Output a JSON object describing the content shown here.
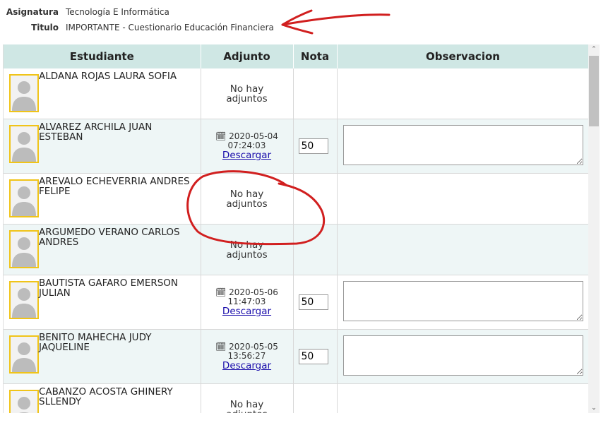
{
  "meta": {
    "asignatura_label": "Asignatura",
    "asignatura_value": "Tecnología E Informática",
    "titulo_label": "Titulo",
    "titulo_value": "IMPORTANTE - Cuestionario Educación Financiera"
  },
  "table": {
    "headers": [
      "Estudiante",
      "Adjunto",
      "Nota",
      "Observacion"
    ],
    "rows": [
      {
        "name": "ALDANA ROJAS LAURA SOFIA",
        "no_attachment": "No hay adjuntos"
      },
      {
        "name": "ALVAREZ ARCHILA JUAN ESTEBAN",
        "date": "2020-05-04",
        "time": "07:24:03",
        "download": "Descargar",
        "nota": "50"
      },
      {
        "name": "AREVALO ECHEVERRIA ANDRES FELIPE",
        "no_attachment": "No hay adjuntos"
      },
      {
        "name": "ARGUMEDO VERANO CARLOS ANDRES",
        "no_attachment": "No hay adjuntos"
      },
      {
        "name": "BAUTISTA GAFARO EMERSON JULIAN",
        "date": "2020-05-06",
        "time": "11:47:03",
        "download": "Descargar",
        "nota": "50"
      },
      {
        "name": "BENITO MAHECHA JUDY JAQUELINE",
        "date": "2020-05-05",
        "time": "13:56:27",
        "download": "Descargar",
        "nota": "50"
      },
      {
        "name": "CABANZO ACOSTA GHINERY SLLENDY",
        "no_attachment": "No hay adjuntos"
      }
    ]
  },
  "colors": {
    "header_bg": "#cfe7e4",
    "alt_row": "#eef6f6",
    "avatar_border": "#f0c419",
    "annotation": "#d11f1f",
    "link": "#1a0dab"
  },
  "icons": {
    "calendar": "calendar-icon",
    "avatar": "user-avatar-icon"
  }
}
